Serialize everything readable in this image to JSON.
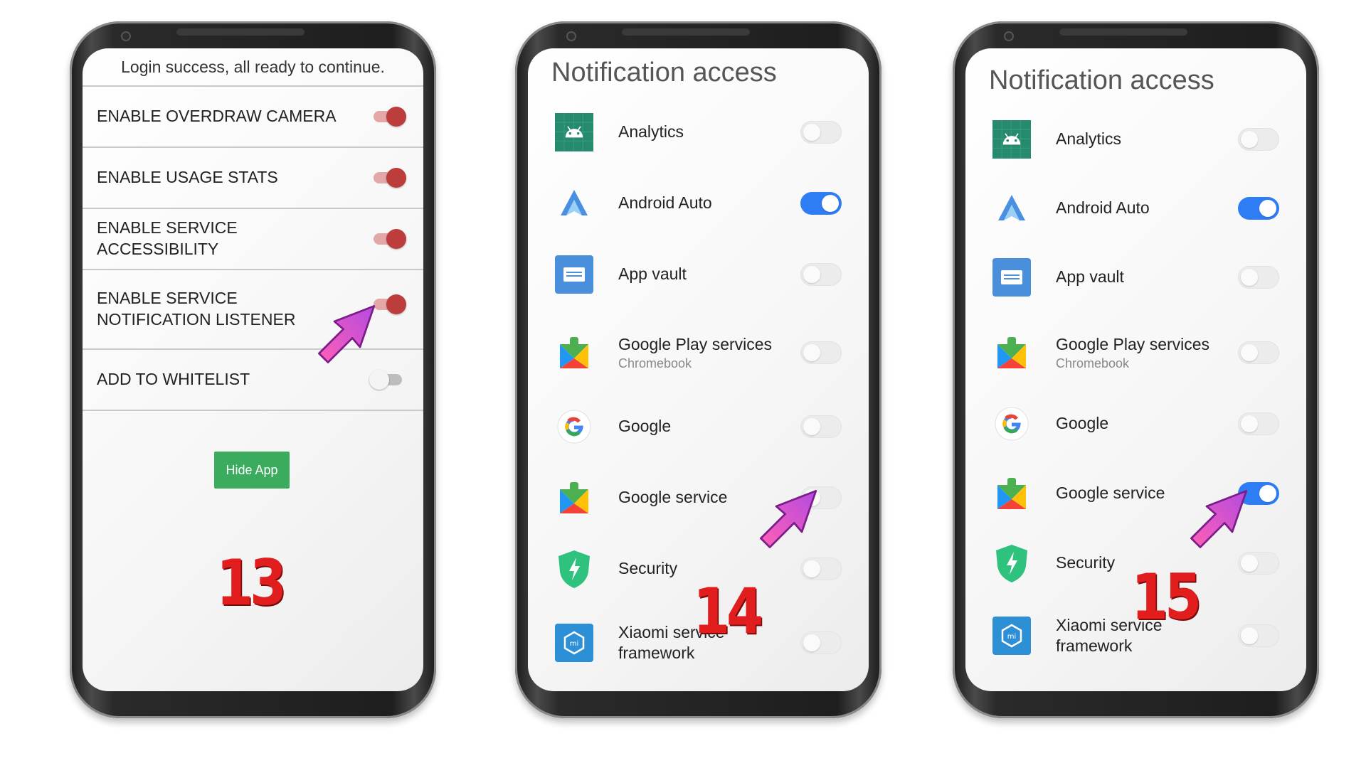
{
  "screen1": {
    "header": "Login success, all ready to continue.",
    "rows": [
      {
        "label": "ENABLE OVERDRAW CAMERA",
        "on": true
      },
      {
        "label": "ENABLE USAGE STATS",
        "on": true
      },
      {
        "label": "ENABLE SERVICE ACCESSIBILITY",
        "on": true
      },
      {
        "label": "ENABLE SERVICE NOTIFICATION LISTENER",
        "on": true
      },
      {
        "label": "ADD TO WHITELIST",
        "on": false
      }
    ],
    "hide_button": "Hide App",
    "step": "13"
  },
  "screen2": {
    "title": "Notification access",
    "step": "14",
    "items": [
      {
        "label": "Analytics",
        "icon": "android-icon",
        "on": false
      },
      {
        "label": "Android Auto",
        "icon": "android-auto-icon",
        "on": true
      },
      {
        "label": "App vault",
        "icon": "app-vault-icon",
        "on": false
      },
      {
        "label": "Google Play services",
        "sub": "Chromebook",
        "icon": "play-services-icon",
        "on": false
      },
      {
        "label": "Google",
        "icon": "google-g-icon",
        "on": false
      },
      {
        "label": "Google service",
        "icon": "play-services-icon",
        "on": false
      },
      {
        "label": "Security",
        "icon": "security-shield-icon",
        "on": false
      },
      {
        "label": "Xiaomi service framework",
        "icon": "xiaomi-icon",
        "on": false
      }
    ]
  },
  "screen3": {
    "title": "Notification access",
    "step": "15",
    "items": [
      {
        "label": "Analytics",
        "icon": "android-icon",
        "on": false
      },
      {
        "label": "Android Auto",
        "icon": "android-auto-icon",
        "on": true
      },
      {
        "label": "App vault",
        "icon": "app-vault-icon",
        "on": false
      },
      {
        "label": "Google Play services",
        "sub": "Chromebook",
        "icon": "play-services-icon",
        "on": false
      },
      {
        "label": "Google",
        "icon": "google-g-icon",
        "on": false
      },
      {
        "label": "Google service",
        "icon": "play-services-icon",
        "on": true
      },
      {
        "label": "Security",
        "icon": "security-shield-icon",
        "on": false
      },
      {
        "label": "Xiaomi service framework",
        "icon": "xiaomi-icon",
        "on": false
      }
    ]
  },
  "colors": {
    "accent_red": "#bd3c3c",
    "toggle_blue": "#2f7df5",
    "button_green": "#3bab5e",
    "step_red": "#e11d1d",
    "arrow_pink": "#e85ad8"
  }
}
